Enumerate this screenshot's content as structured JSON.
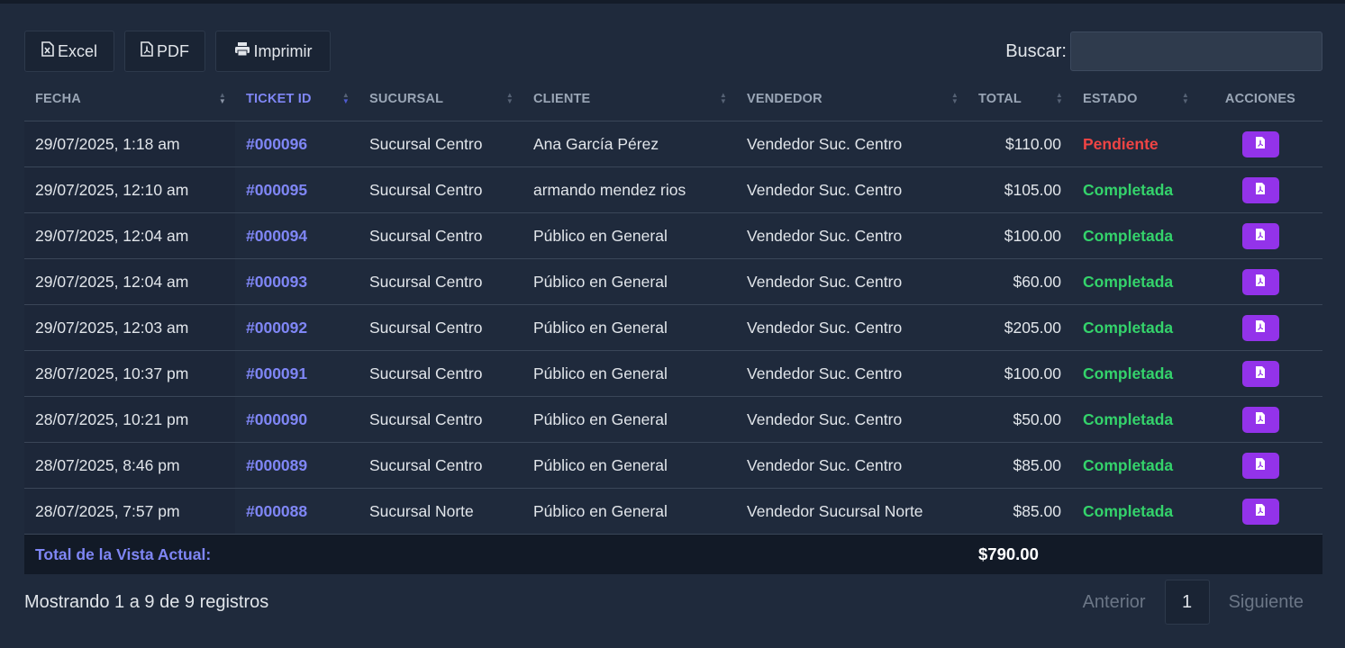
{
  "toolbar": {
    "excel_label": "Excel",
    "pdf_label": "PDF",
    "print_label": "Imprimir",
    "search_label": "Buscar:",
    "search_value": ""
  },
  "table": {
    "headers": {
      "fecha": "FECHA",
      "ticket": "TICKET ID",
      "sucursal": "SUCURSAL",
      "cliente": "CLIENTE",
      "vendedor": "VENDEDOR",
      "total": "TOTAL",
      "estado": "ESTADO",
      "acciones": "ACCIONES"
    },
    "rows": [
      {
        "fecha": "29/07/2025, 1:18 am",
        "ticket": "#000096",
        "sucursal": "Sucursal Centro",
        "cliente": "Ana García Pérez",
        "vendedor": "Vendedor Suc. Centro",
        "total": "$110.00",
        "estado": "Pendiente"
      },
      {
        "fecha": "29/07/2025, 12:10 am",
        "ticket": "#000095",
        "sucursal": "Sucursal Centro",
        "cliente": "armando mendez rios",
        "vendedor": "Vendedor Suc. Centro",
        "total": "$105.00",
        "estado": "Completada"
      },
      {
        "fecha": "29/07/2025, 12:04 am",
        "ticket": "#000094",
        "sucursal": "Sucursal Centro",
        "cliente": "Público en General",
        "vendedor": "Vendedor Suc. Centro",
        "total": "$100.00",
        "estado": "Completada"
      },
      {
        "fecha": "29/07/2025, 12:04 am",
        "ticket": "#000093",
        "sucursal": "Sucursal Centro",
        "cliente": "Público en General",
        "vendedor": "Vendedor Suc. Centro",
        "total": "$60.00",
        "estado": "Completada"
      },
      {
        "fecha": "29/07/2025, 12:03 am",
        "ticket": "#000092",
        "sucursal": "Sucursal Centro",
        "cliente": "Público en General",
        "vendedor": "Vendedor Suc. Centro",
        "total": "$205.00",
        "estado": "Completada"
      },
      {
        "fecha": "28/07/2025, 10:37 pm",
        "ticket": "#000091",
        "sucursal": "Sucursal Centro",
        "cliente": "Público en General",
        "vendedor": "Vendedor Suc. Centro",
        "total": "$100.00",
        "estado": "Completada"
      },
      {
        "fecha": "28/07/2025, 10:21 pm",
        "ticket": "#000090",
        "sucursal": "Sucursal Centro",
        "cliente": "Público en General",
        "vendedor": "Vendedor Suc. Centro",
        "total": "$50.00",
        "estado": "Completada"
      },
      {
        "fecha": "28/07/2025, 8:46 pm",
        "ticket": "#000089",
        "sucursal": "Sucursal Centro",
        "cliente": "Público en General",
        "vendedor": "Vendedor Suc. Centro",
        "total": "$85.00",
        "estado": "Completada"
      },
      {
        "fecha": "28/07/2025, 7:57 pm",
        "ticket": "#000088",
        "sucursal": "Sucursal Norte",
        "cliente": "Público en General",
        "vendedor": "Vendedor Sucursal Norte",
        "total": "$85.00",
        "estado": "Completada"
      }
    ],
    "footer": {
      "label": "Total de la Vista Actual:",
      "total": "$790.00"
    }
  },
  "pagination": {
    "info": "Mostrando 1 a 9 de 9 registros",
    "prev": "Anterior",
    "current": "1",
    "next": "Siguiente"
  },
  "colors": {
    "background": "#1f2a3c",
    "accent": "#7f86f5",
    "pending": "#ef4444",
    "completed": "#34d36b",
    "action_button": "#9333ea"
  },
  "icons": {
    "excel": "file-excel-icon",
    "pdf": "file-pdf-icon",
    "print": "printer-icon",
    "sort": "sort-arrows-icon"
  }
}
